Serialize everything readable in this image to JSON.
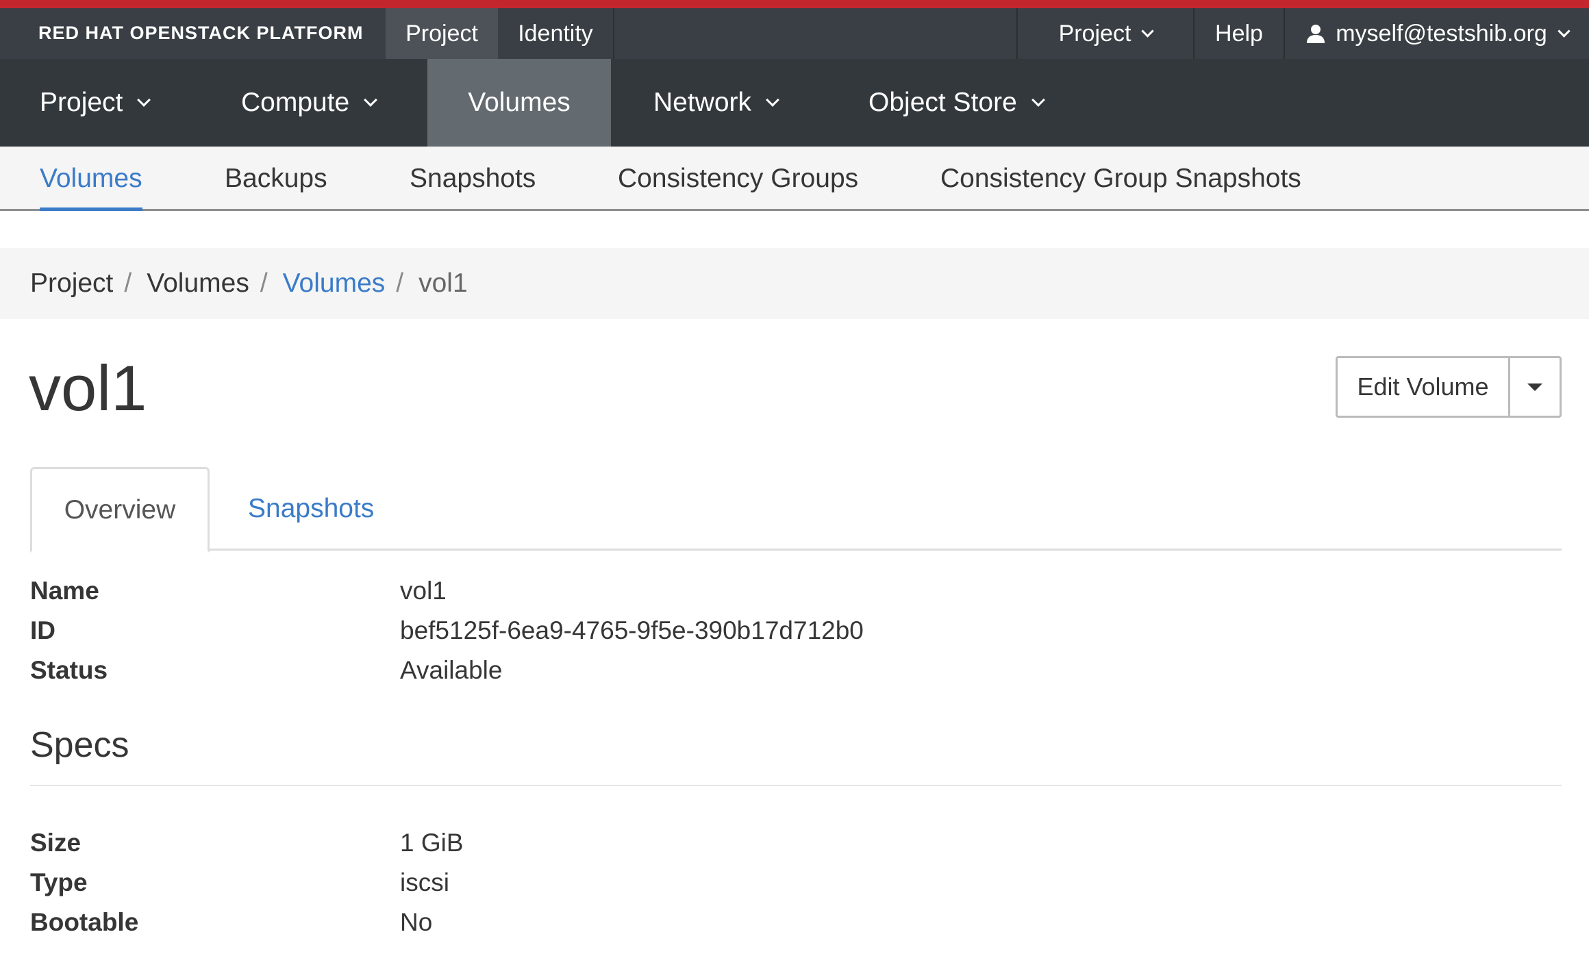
{
  "masthead": {
    "brand": "RED HAT OPENSTACK PLATFORM",
    "context_tabs": [
      "Project",
      "Identity"
    ],
    "project_menu": "Project",
    "help": "Help",
    "user": "myself@testshib.org",
    "accent_color": "#c4262e"
  },
  "primary_nav": {
    "items": [
      "Project",
      "Compute",
      "Volumes",
      "Network",
      "Object Store"
    ],
    "active": "Volumes"
  },
  "secondary_nav": {
    "items": [
      "Volumes",
      "Backups",
      "Snapshots",
      "Consistency Groups",
      "Consistency Group Snapshots"
    ],
    "active": "Volumes"
  },
  "breadcrumb": {
    "items": [
      "Project",
      "Volumes",
      "Volumes",
      "vol1"
    ],
    "separator": "/"
  },
  "page": {
    "title": "vol1",
    "edit_button": "Edit Volume"
  },
  "tabs": {
    "items": [
      "Overview",
      "Snapshots"
    ],
    "active": "Overview"
  },
  "overview": {
    "rows": [
      {
        "label": "Name",
        "value": "vol1"
      },
      {
        "label": "ID",
        "value": "bef5125f-6ea9-4765-9f5e-390b17d712b0"
      },
      {
        "label": "Status",
        "value": "Available"
      }
    ]
  },
  "specs": {
    "title": "Specs",
    "rows": [
      {
        "label": "Size",
        "value": "1 GiB"
      },
      {
        "label": "Type",
        "value": "iscsi"
      },
      {
        "label": "Bootable",
        "value": "No"
      }
    ]
  }
}
